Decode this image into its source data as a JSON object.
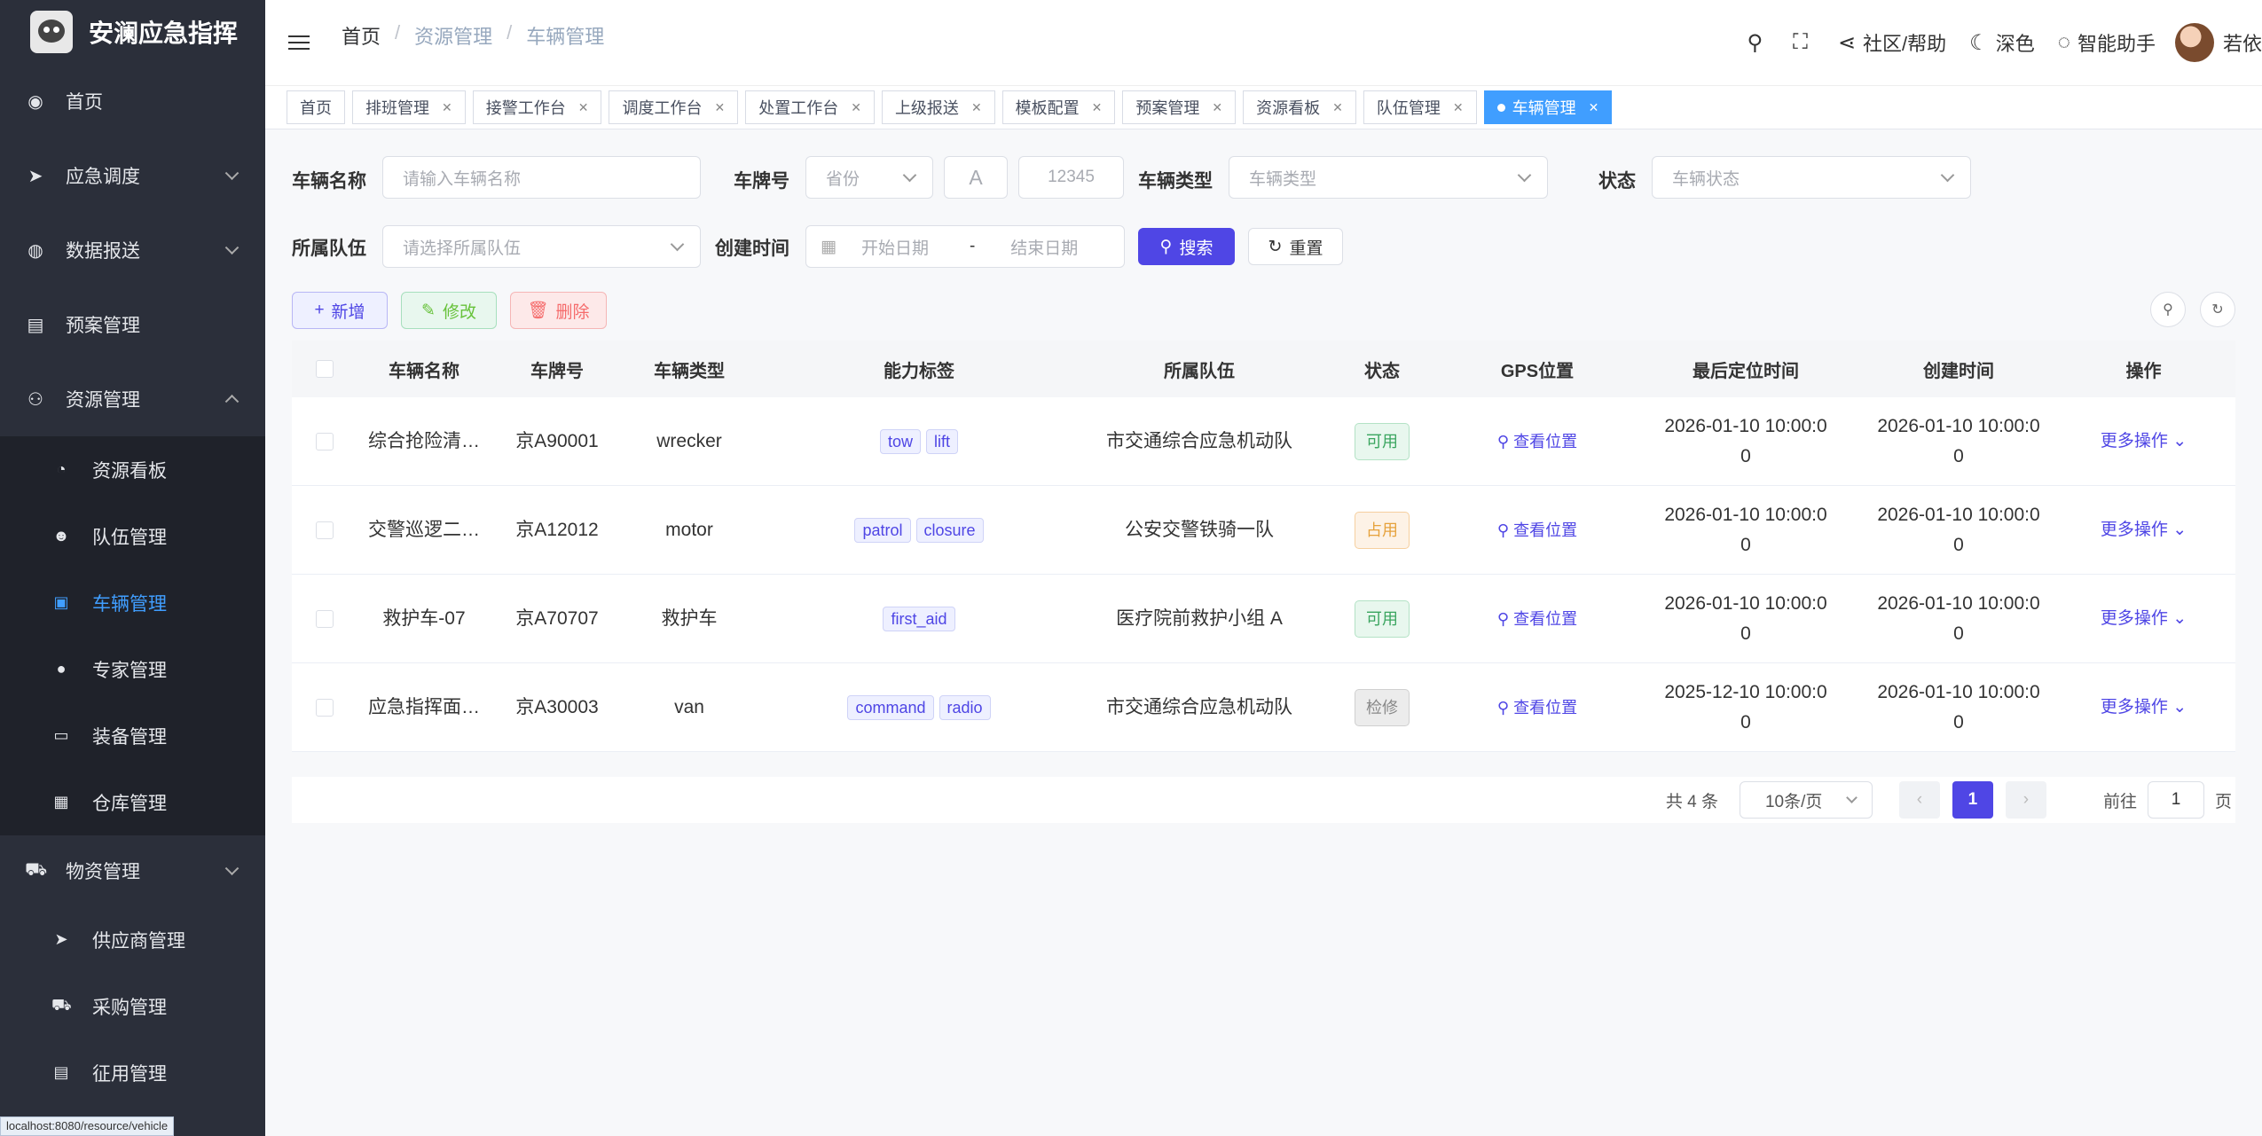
{
  "app": {
    "title": "安澜应急指挥"
  },
  "sidebar": {
    "items": [
      {
        "label": "首页",
        "icon": "dashboard-icon"
      },
      {
        "label": "应急调度",
        "icon": "paper-plane-icon"
      },
      {
        "label": "数据报送",
        "icon": "globe-icon"
      },
      {
        "label": "预案管理",
        "icon": "document-icon"
      },
      {
        "label": "资源管理",
        "icon": "tree-icon"
      }
    ],
    "sub": [
      {
        "label": "资源看板",
        "icon": "gauge-icon"
      },
      {
        "label": "队伍管理",
        "icon": "users-icon"
      },
      {
        "label": "车辆管理",
        "icon": "briefcase-icon"
      },
      {
        "label": "专家管理",
        "icon": "user-icon"
      },
      {
        "label": "装备管理",
        "icon": "toolbox-icon"
      },
      {
        "label": "仓库管理",
        "icon": "grid-icon"
      }
    ],
    "after": [
      {
        "label": "物资管理",
        "icon": "cart-icon"
      },
      {
        "label": "供应商管理",
        "icon": "paper-plane-icon"
      },
      {
        "label": "采购管理",
        "icon": "cart-icon"
      },
      {
        "label": "征用管理",
        "icon": "document-icon"
      }
    ],
    "status_url": "localhost:8080/resource/vehicle"
  },
  "header": {
    "breadcrumb": [
      "首页",
      "资源管理",
      "车辆管理"
    ],
    "community": "社区/帮助",
    "dark": "深色",
    "assistant": "智能助手",
    "user": "若依"
  },
  "tags": [
    "首页",
    "排班管理",
    "接警工作台",
    "调度工作台",
    "处置工作台",
    "上级报送",
    "模板配置",
    "预案管理",
    "资源看板",
    "队伍管理"
  ],
  "active_tag": "车辆管理",
  "search": {
    "name_label": "车辆名称",
    "name_placeholder": "请输入车辆名称",
    "plate_label": "车牌号",
    "province_placeholder": "省份",
    "letter_placeholder": "A",
    "number_placeholder": "12345",
    "type_label": "车辆类型",
    "type_placeholder": "车辆类型",
    "status_label": "状态",
    "status_placeholder": "车辆状态",
    "team_label": "所属队伍",
    "team_placeholder": "请选择所属队伍",
    "time_label": "创建时间",
    "start_placeholder": "开始日期",
    "range_sep": "-",
    "end_placeholder": "结束日期",
    "search_btn": "搜索",
    "reset_btn": "重置"
  },
  "toolbar": {
    "add": "新增",
    "edit": "修改",
    "delete": "删除"
  },
  "table": {
    "headers": [
      "车辆名称",
      "车牌号",
      "车辆类型",
      "能力标签",
      "所属队伍",
      "状态",
      "GPS位置",
      "最后定位时间",
      "创建时间",
      "操作"
    ],
    "rows": [
      {
        "name": "综合抢险清…",
        "plate": "京A90001",
        "type": "wrecker",
        "tags": [
          "tow",
          "lift"
        ],
        "team": "市交通综合应急机动队",
        "status": "可用",
        "status_kind": "ok",
        "gps": "查看位置",
        "loc_time_1": "2026-01-10 10:00:0",
        "loc_time_2": "0",
        "created_1": "2026-01-10 10:00:0",
        "created_2": "0",
        "ops": "更多操作"
      },
      {
        "name": "交警巡逻二…",
        "plate": "京A12012",
        "type": "motor",
        "tags": [
          "patrol",
          "closure"
        ],
        "team": "公安交警铁骑一队",
        "status": "占用",
        "status_kind": "busy",
        "gps": "查看位置",
        "loc_time_1": "2026-01-10 10:00:0",
        "loc_time_2": "0",
        "created_1": "2026-01-10 10:00:0",
        "created_2": "0",
        "ops": "更多操作"
      },
      {
        "name": "救护车-07",
        "plate": "京A70707",
        "type": "救护车",
        "tags": [
          "first_aid"
        ],
        "team": "医疗院前救护小组 A",
        "status": "可用",
        "status_kind": "ok",
        "gps": "查看位置",
        "loc_time_1": "2026-01-10 10:00:0",
        "loc_time_2": "0",
        "created_1": "2026-01-10 10:00:0",
        "created_2": "0",
        "ops": "更多操作"
      },
      {
        "name": "应急指挥面…",
        "plate": "京A30003",
        "type": "van",
        "tags": [
          "command",
          "radio"
        ],
        "team": "市交通综合应急机动队",
        "status": "检修",
        "status_kind": "fix",
        "gps": "查看位置",
        "loc_time_1": "2025-12-10 10:00:0",
        "loc_time_2": "0",
        "created_1": "2026-01-10 10:00:0",
        "created_2": "0",
        "ops": "更多操作"
      }
    ]
  },
  "pagination": {
    "total": "共 4 条",
    "page_size": "10条/页",
    "current": "1",
    "goto_label": "前往",
    "goto_value": "1",
    "page_unit": "页"
  },
  "colors": {
    "primary": "#4f46e5",
    "sidebar_bg": "#2b2f3a",
    "active_menu": "#409eff"
  }
}
